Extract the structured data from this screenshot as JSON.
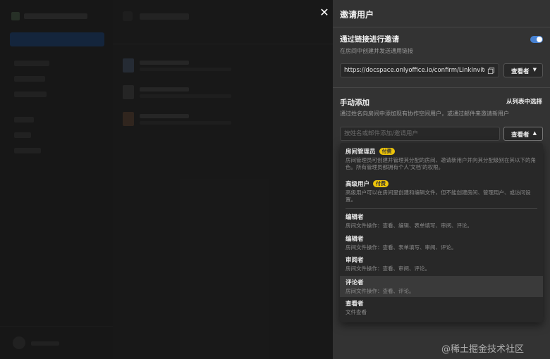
{
  "panel": {
    "title": "邀请用户",
    "link_section": {
      "title": "通过链接进行邀请",
      "subtitle": "在房间中创建并发送通用链接",
      "link": "https://docspace.onlyoffice.io/confirm/LinkInvite?typ",
      "toggle_on": true,
      "access_label": "查看者"
    },
    "manual_section": {
      "title": "手动添加",
      "from_list": "从列表中选择",
      "subtitle": "通过姓名向房间中添加现有协作空间用户，或通过邮件来邀请新用户",
      "search_placeholder": "按姓名或邮件添加/邀请用户",
      "access_label": "查看者"
    }
  },
  "roles": [
    {
      "name": "房间管理员",
      "badge": "付费",
      "desc": "房间管理员可创建并管理其分配的房间、邀请新用户并向其分配级别在其以下的角色。所有管理员都拥有个人'文档'的权限。"
    },
    {
      "name": "高级用户",
      "badge": "付费",
      "desc": "高级用户可以在房间里创建和编辑文件，但不能创建房间、管理用户、或访问设置。"
    },
    {
      "name": "编辑者",
      "badge": "",
      "desc": "房间文件操作：查看、编辑、表单填写、审阅、评论。"
    },
    {
      "name": "编辑者",
      "badge": "",
      "desc": "房间文件操作：查看、表单填写、审阅、评论。"
    },
    {
      "name": "审阅者",
      "badge": "",
      "desc": "房间文件操作：查看、审阅、评论。"
    },
    {
      "name": "评论者",
      "badge": "",
      "desc": "房间文件操作：查看、评论。"
    },
    {
      "name": "查看者",
      "badge": "",
      "desc": "文件查看"
    }
  ],
  "close_icon": "close-icon",
  "watermark": "@稀土掘金技术社区",
  "colors": {
    "accent": "#4781d1",
    "badge": "#edc409",
    "panel_bg": "#333333"
  }
}
